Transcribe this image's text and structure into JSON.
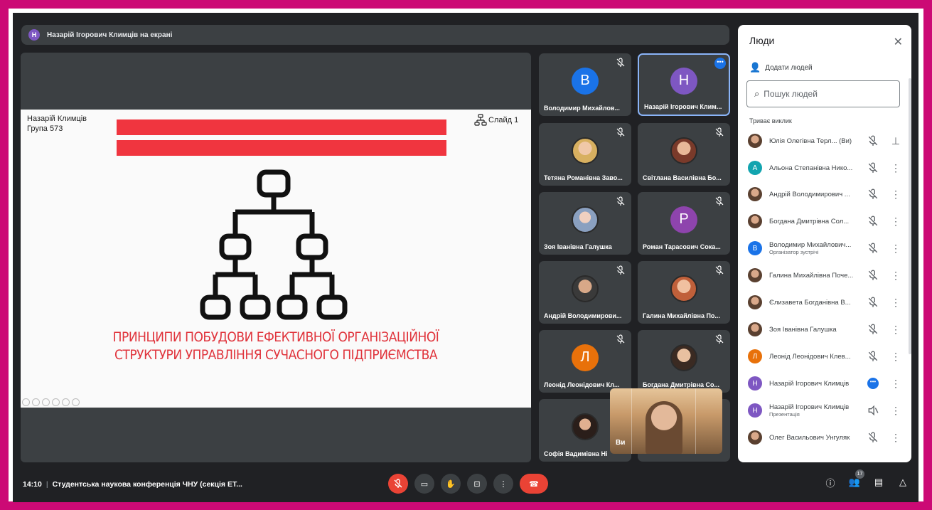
{
  "banner": {
    "avatar_letter": "Н",
    "text": "Назарій Ігорович Климців на екрані"
  },
  "slide": {
    "author_line1": "Назарій Климців",
    "author_line2": "Група 573",
    "slide_label": "Слайд 1",
    "title_line1": "ПРИНЦИПИ ПОБУДОВИ ЕФЕКТИВНОЇ ОРГАНІЗАЦІЙНОЇ",
    "title_line2": "СТРУКТУРИ УПРАВЛІННЯ СУЧАСНОГО ПІДПРИЄМСТВА",
    "accent_color": "#f0353f"
  },
  "tiles": [
    {
      "name": "Володимир Михайлов...",
      "letter": "В",
      "color": "#1a73e8"
    },
    {
      "name": "Назарій Ігорович Клим...",
      "letter": "Н",
      "color": "#7e57c2"
    },
    {
      "name": "Тетяна Романівна Заво..."
    },
    {
      "name": "Світлана Василівна Бо..."
    },
    {
      "name": "Зоя Іванівна Галушка"
    },
    {
      "name": "Роман Тарасович Сока...",
      "letter": "Р",
      "color": "#8e44ad"
    },
    {
      "name": "Андрій Володимирови..."
    },
    {
      "name": "Галина Михайлівна По..."
    },
    {
      "name": "Леонід Леонідович Кл...",
      "letter": "Л",
      "color": "#e8710a"
    },
    {
      "name": "Богдана Дмитрівна Со..."
    },
    {
      "name": "Софія Вадимівна Ні"
    }
  ],
  "self_view": {
    "label": "Ви"
  },
  "people": {
    "title": "Люди",
    "add_label": "Додати людей",
    "search_placeholder": "Пошук людей",
    "section": "Триває виклик",
    "rows": [
      {
        "name": "Юлія Олегівна Терл... (Ви)",
        "sub": "",
        "letter": "",
        "color": "",
        "action": "pin"
      },
      {
        "name": "Альона Степанівна Нико...",
        "sub": "",
        "letter": "А",
        "color": "#12a4af",
        "action": "more"
      },
      {
        "name": "Андрій Володимирович ...",
        "sub": "",
        "letter": "",
        "color": "",
        "action": "more"
      },
      {
        "name": "Богдана Дмитрівна Сол...",
        "sub": "",
        "letter": "",
        "color": "",
        "action": "more"
      },
      {
        "name": "Володимир Михайлович...",
        "sub": "Організатор зустрічі",
        "letter": "В",
        "color": "#1a73e8",
        "action": "more"
      },
      {
        "name": "Галина Михайлівна Поче...",
        "sub": "",
        "letter": "",
        "color": "",
        "action": "more"
      },
      {
        "name": "Єлизавета Богданівна В...",
        "sub": "",
        "letter": "",
        "color": "",
        "action": "more"
      },
      {
        "name": "Зоя Іванівна Галушка",
        "sub": "",
        "letter": "",
        "color": "",
        "action": "more"
      },
      {
        "name": "Леонід Леонідович Клев...",
        "sub": "",
        "letter": "Л",
        "color": "#e8710a",
        "action": "more"
      },
      {
        "name": "Назарій Ігорович Климців",
        "sub": "",
        "letter": "Н",
        "color": "#7e57c2",
        "action": "more"
      },
      {
        "name": "Назарій Ігорович Климців",
        "sub": "Презентація",
        "letter": "Н",
        "color": "#7e57c2",
        "action": "more"
      },
      {
        "name": "Олег Васильович Унгуляк",
        "sub": "",
        "letter": "",
        "color": "",
        "action": "more"
      }
    ]
  },
  "bottom": {
    "time": "14:10",
    "meeting": "Студентська наукова конференція ЧНУ (секція ЕТ...",
    "participants_count": "17"
  }
}
